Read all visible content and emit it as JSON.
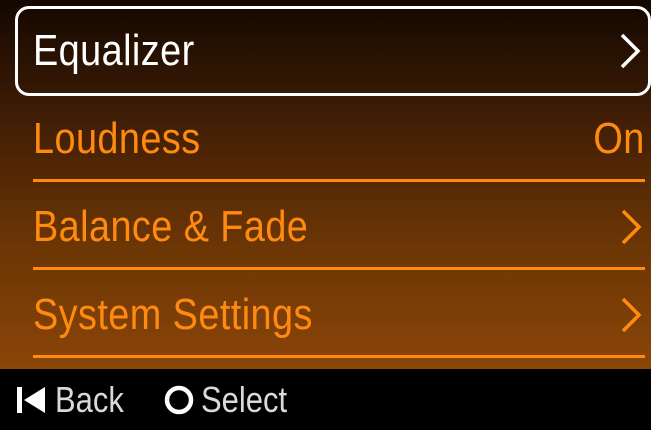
{
  "menu": {
    "items": [
      {
        "label": "Equalizer",
        "value": "",
        "chevron": true
      },
      {
        "label": "Loudness",
        "value": "On",
        "chevron": false
      },
      {
        "label": "Balance & Fade",
        "value": "",
        "chevron": true
      },
      {
        "label": "System Settings",
        "value": "",
        "chevron": true
      }
    ],
    "selected_index": 0
  },
  "footer": {
    "back_label": "Back",
    "select_label": "Select"
  },
  "colors": {
    "accent": "#ff8a10",
    "selected_text": "#ffffff",
    "footer_text": "#d9d9d9"
  },
  "icons": {
    "chevron": "chevron-right-icon",
    "back": "skip-back-icon",
    "select": "circle-select-icon"
  }
}
